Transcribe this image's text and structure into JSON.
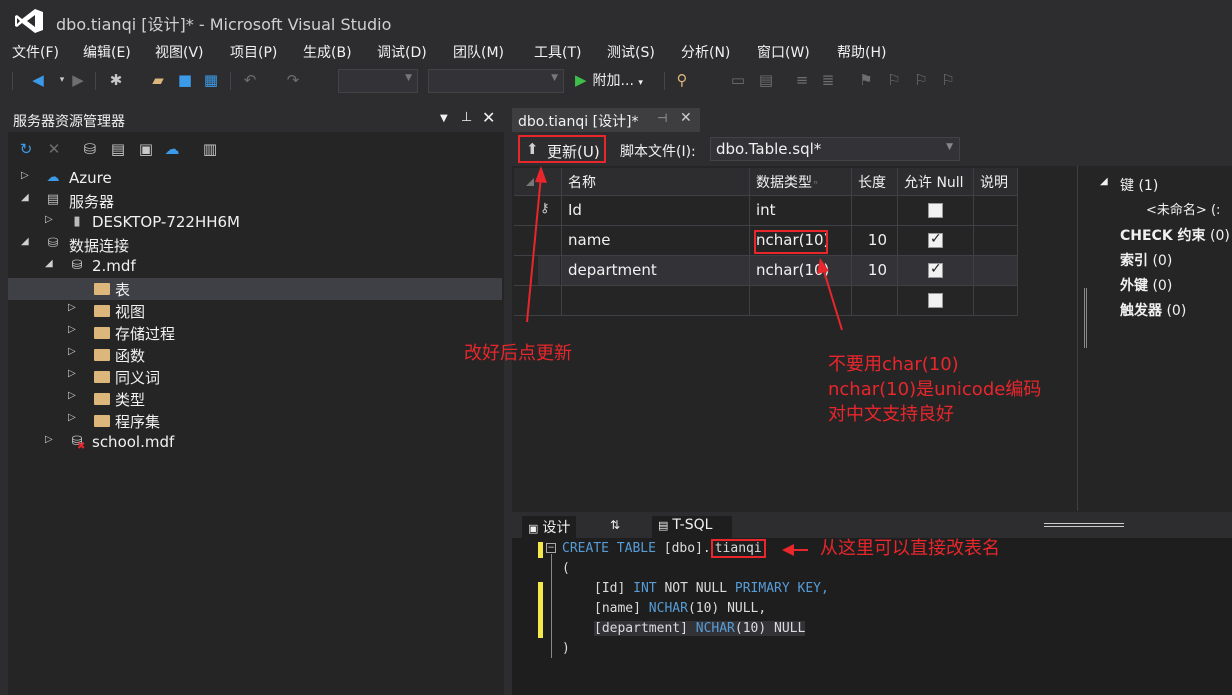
{
  "window": {
    "title": "dbo.tianqi [设计]* - Microsoft Visual Studio"
  },
  "menu": [
    "文件(F)",
    "编辑(E)",
    "视图(V)",
    "项目(P)",
    "生成(B)",
    "调试(D)",
    "团队(M)",
    "工具(T)",
    "测试(S)",
    "分析(N)",
    "窗口(W)",
    "帮助(H)"
  ],
  "toolbar": {
    "run_label": "附加..."
  },
  "server_explorer": {
    "title": "服务器资源管理器",
    "tree": [
      {
        "label": "Azure",
        "icon": "azure-cloud-icon"
      },
      {
        "label": "服务器",
        "icon": "server-icon"
      },
      {
        "label": "DESKTOP-722HH6M",
        "icon": "computer-icon"
      },
      {
        "label": "数据连接",
        "icon": "data-connection-icon"
      },
      {
        "label": "2.mdf",
        "icon": "database-icon"
      },
      {
        "label": "表",
        "icon": "folder-icon"
      },
      {
        "label": "视图",
        "icon": "folder-icon"
      },
      {
        "label": "存储过程",
        "icon": "folder-icon"
      },
      {
        "label": "函数",
        "icon": "folder-icon"
      },
      {
        "label": "同义词",
        "icon": "folder-icon"
      },
      {
        "label": "类型",
        "icon": "folder-icon"
      },
      {
        "label": "程序集",
        "icon": "folder-icon"
      },
      {
        "label": "school.mdf",
        "icon": "database-error-icon"
      }
    ]
  },
  "doc_tab": {
    "label": "dbo.tianqi [设计]*"
  },
  "designer": {
    "update_label": "更新(U)",
    "script_file_label": "脚本文件(I):",
    "script_file_value": "dbo.Table.sql*",
    "columns": [
      "名称",
      "数据类型",
      "长度",
      "允许 Null",
      "说明"
    ],
    "rows": [
      {
        "name": "Id",
        "type": "int",
        "length": "",
        "allow_null": false,
        "key": true
      },
      {
        "name": "name",
        "type": "nchar(10)",
        "length": "10",
        "allow_null": true,
        "key": false
      },
      {
        "name": "department",
        "type": "nchar(10)",
        "length": "10",
        "allow_null": true,
        "key": false
      },
      {
        "name": "",
        "type": "",
        "length": "",
        "allow_null": false,
        "key": false
      }
    ]
  },
  "properties": {
    "keys": "键 (1)",
    "unnamed": "<未命名>",
    "unnamed_suffix": "(:",
    "check_label": "CHECK 约束",
    "check_count": "(0)",
    "index_label": "索引",
    "index_count": "(0)",
    "fk_label": "外键",
    "fk_count": "(0)",
    "trigger_label": "触发器",
    "trigger_count": "(0)"
  },
  "bottom_tabs": [
    "设计",
    "T-SQL"
  ],
  "sql": {
    "create": "CREATE",
    "table": "TABLE",
    "schema": "[dbo].",
    "table_name": "tianqi",
    "open": "(",
    "close": ")",
    "line1_col": "[Id]",
    "line1_type": "INT",
    "line1_mid": "NOT NULL",
    "line1_pk": "PRIMARY KEY,",
    "line2_col": "[name]",
    "line2_type": "NCHAR",
    "line2_rest": "(10) NULL,",
    "line3_col": "[department]",
    "line3_type": "NCHAR",
    "line3_rest": "(10) NULL"
  },
  "annotations": {
    "update_hint": "改好后点更新",
    "nchar_hint_1": "不要用char(10)",
    "nchar_hint_2": "nchar(10)是unicode编码",
    "nchar_hint_3": "对中文支持良好",
    "rename_hint": "从这里可以直接改表名"
  },
  "colors": {
    "accent_red": "#e8262b",
    "keyword_blue": "#569cd6",
    "background": "#2d2d30"
  }
}
